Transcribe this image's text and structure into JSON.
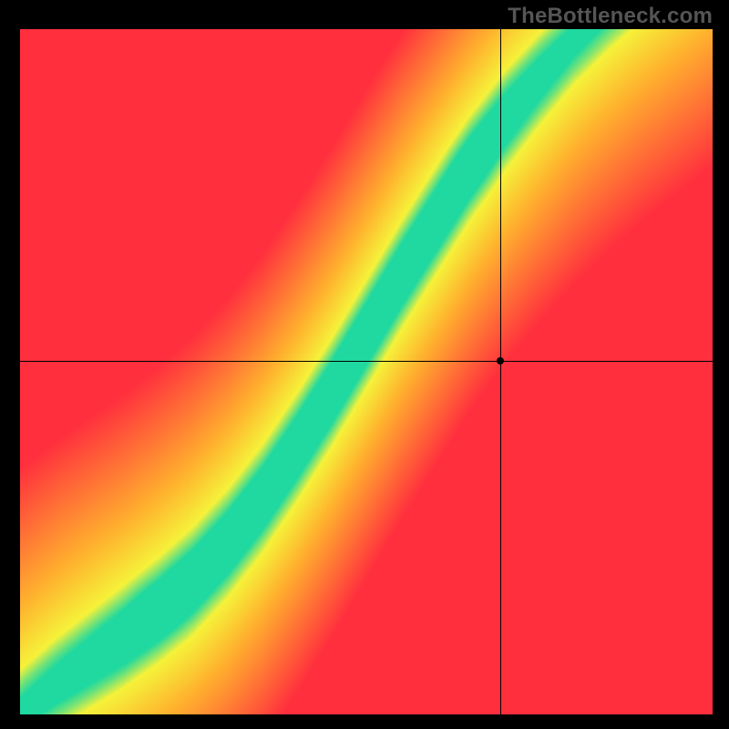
{
  "watermark": "TheBottleneck.com",
  "chart_data": {
    "type": "heatmap",
    "title": "",
    "xlabel": "",
    "ylabel": "",
    "xlim": [
      0,
      1
    ],
    "ylim": [
      0,
      1
    ],
    "crosshair": {
      "x": 0.693,
      "y": 0.516
    },
    "marker": {
      "x": 0.693,
      "y": 0.516
    },
    "optimal_curve": [
      {
        "x": 0.0,
        "y": 0.0
      },
      {
        "x": 0.05,
        "y": 0.04
      },
      {
        "x": 0.1,
        "y": 0.075
      },
      {
        "x": 0.15,
        "y": 0.11
      },
      {
        "x": 0.2,
        "y": 0.15
      },
      {
        "x": 0.25,
        "y": 0.195
      },
      {
        "x": 0.3,
        "y": 0.25
      },
      {
        "x": 0.35,
        "y": 0.315
      },
      {
        "x": 0.4,
        "y": 0.39
      },
      {
        "x": 0.45,
        "y": 0.47
      },
      {
        "x": 0.5,
        "y": 0.555
      },
      {
        "x": 0.55,
        "y": 0.64
      },
      {
        "x": 0.6,
        "y": 0.72
      },
      {
        "x": 0.65,
        "y": 0.8
      },
      {
        "x": 0.7,
        "y": 0.87
      },
      {
        "x": 0.75,
        "y": 0.93
      },
      {
        "x": 0.8,
        "y": 0.985
      },
      {
        "x": 0.85,
        "y": 1.03
      },
      {
        "x": 0.9,
        "y": 1.07
      },
      {
        "x": 1.0,
        "y": 1.14
      }
    ],
    "colors": {
      "optimal": "#1fd9a0",
      "near": "#f6f23a",
      "mid": "#ffb22e",
      "far": "#ff2f3e"
    },
    "band_half_width": 0.045,
    "falloff": 0.35,
    "resolution": 200,
    "legend": []
  }
}
